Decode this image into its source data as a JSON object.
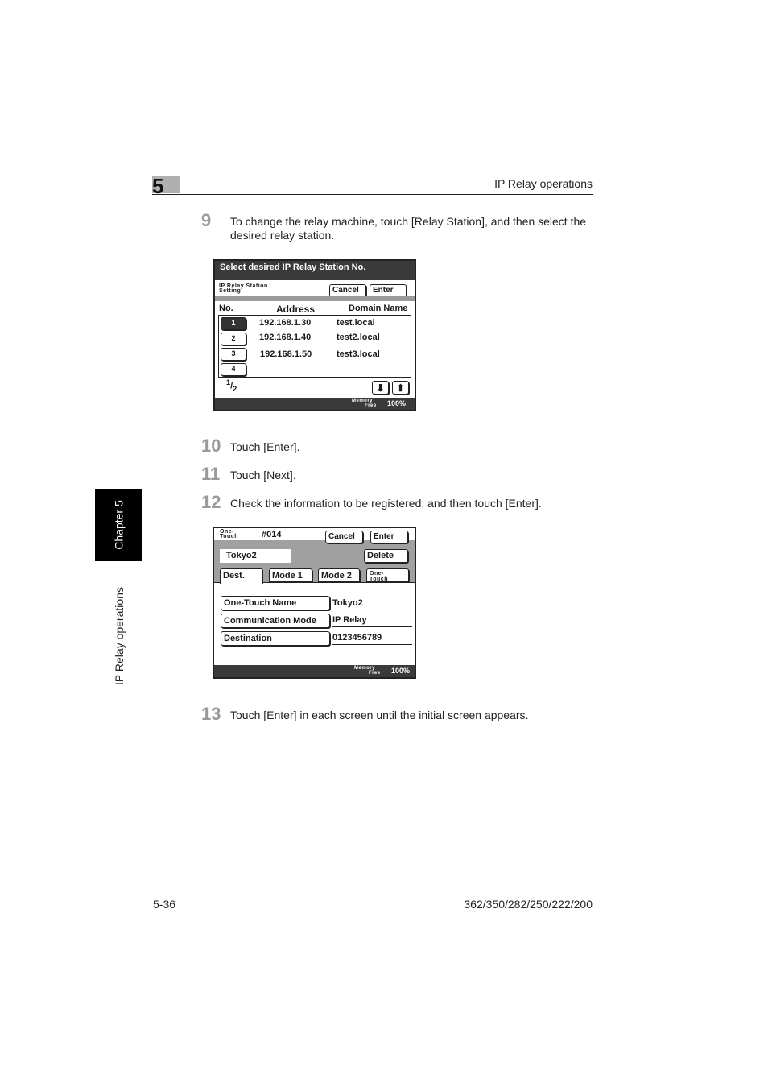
{
  "header": {
    "chapter_number": "5",
    "section_title": "IP Relay operations"
  },
  "side_tab": {
    "chapter_label": "Chapter 5",
    "section_label": "IP Relay operations"
  },
  "steps": [
    {
      "num": "9",
      "text_line1": "To change the relay machine, touch [Relay Station], and then select the",
      "text_line2": "desired relay station."
    },
    {
      "num": "10",
      "text": "Touch [Enter]."
    },
    {
      "num": "11",
      "text": "Touch [Next]."
    },
    {
      "num": "12",
      "text": "Check the information to be registered, and then touch [Enter]."
    },
    {
      "num": "13",
      "text": "Touch [Enter] in each screen until the initial screen appears."
    }
  ],
  "screen1": {
    "title": "Select desired IP Relay Station No.",
    "subtitle_line1": "IP Relay Station",
    "subtitle_line2": "Setting",
    "cancel_label": "Cancel",
    "enter_label": "Enter",
    "columns": {
      "no": "No.",
      "address": "Address",
      "domain": "Domain Name"
    },
    "rows": [
      {
        "no": "1",
        "address": "192.168.1.30",
        "domain": "test.local",
        "selected": true
      },
      {
        "no": "2",
        "address": "192.168.1.40",
        "domain": "test2.local",
        "selected": false
      },
      {
        "no": "3",
        "address": "192.168.1.50",
        "domain": "test3.local",
        "selected": false
      },
      {
        "no": "4",
        "address": "",
        "domain": "",
        "selected": false
      }
    ],
    "page_current": "1",
    "page_total": "2",
    "down_icon": "arrow-down",
    "up_icon": "arrow-up",
    "memory_label_line1": "Memory",
    "memory_label_line2": "Free",
    "memory_value": "100%"
  },
  "screen2": {
    "header_label_line1": "One-",
    "header_label_line2": "Touch",
    "entry_number": "#014",
    "cancel_label": "Cancel",
    "enter_label": "Enter",
    "name_value": "Tokyo2",
    "delete_label": "Delete",
    "tabs": [
      {
        "label": "Dest.",
        "active": true
      },
      {
        "label": "Mode 1",
        "active": false
      },
      {
        "label": "Mode 2",
        "active": false
      },
      {
        "label_line1": "One-",
        "label_line2": "Touch",
        "active": false
      }
    ],
    "fields": [
      {
        "label": "One-Touch Name",
        "value": "Tokyo2"
      },
      {
        "label": "Communication Mode",
        "value": "IP Relay"
      },
      {
        "label": "Destination",
        "value": "0123456789"
      }
    ],
    "memory_label_line1": "Memory",
    "memory_label_line2": "Free",
    "memory_value": "100%"
  },
  "footer": {
    "page_number": "5-36",
    "models": "362/350/282/250/222/200"
  }
}
